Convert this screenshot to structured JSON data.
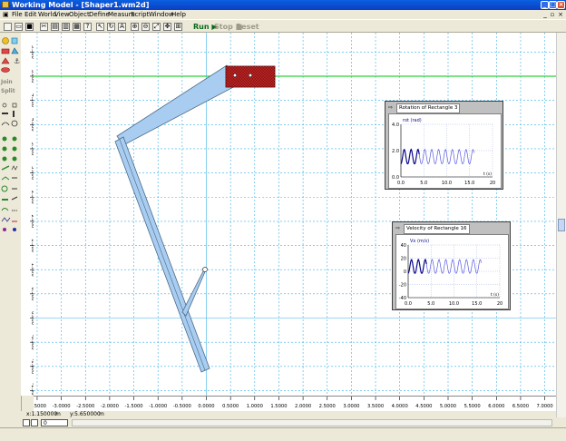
{
  "window": {
    "title": "Working Model - [Shaper1.wm2d]"
  },
  "menu": [
    "File",
    "Edit",
    "World",
    "View",
    "Object",
    "Define",
    "Measure",
    "Script",
    "Window",
    "Help"
  ],
  "toolbar": {
    "run": "Run",
    "stop": "Stop",
    "reset": "Reset"
  },
  "palette": {
    "join": "Join",
    "split": "Split"
  },
  "rulers": {
    "x_ticks": [
      "-3.5000",
      "-3.0000",
      "-2.5000",
      "-2.0000",
      "-1.5000",
      "-1.0000",
      "-0.5000",
      "0.0000",
      "0.5000",
      "1.0000",
      "1.5000",
      "2.0000",
      "2.5000",
      "3.0000",
      "3.5000",
      "4.0000",
      "4.5000",
      "5.0000",
      "5.5000",
      "6.0000",
      "6.5000",
      "7.0000"
    ],
    "y_ticks": [
      "5.500",
      "5.000",
      "4.500",
      "4.000",
      "3.500",
      "3.000",
      "2.500",
      "2.000",
      "1.500",
      "1.000",
      "0.500",
      "0.000",
      "-0.500",
      "-1.000",
      "-1.500"
    ]
  },
  "status": {
    "x": "x:1.150000",
    "x_unit": "m",
    "y": "y:5.650000",
    "y_unit": "m"
  },
  "playback": {
    "frame": "0"
  },
  "graphs": [
    {
      "title": "Rotation of Rectangle 3",
      "series_label": "rot (rad)",
      "x_unit": "t (s)",
      "y_ticks": [
        "4.0",
        "2.0",
        "0.0"
      ],
      "x_ticks": [
        "0.0",
        "5.0",
        "10.0",
        "15.0",
        "20"
      ],
      "chart_data": {
        "type": "line",
        "ylabel": "rot (rad)",
        "xlabel": "t (s)",
        "xlim": [
          0,
          20
        ],
        "ylim": [
          0,
          4
        ],
        "period": 1.5,
        "t_end": 16,
        "y_min": 1.0,
        "y_max": 2.1
      }
    },
    {
      "title": "Velocity of Rectangle 16",
      "series_label": "Vx (m/s)",
      "x_unit": "t (s)",
      "y_ticks": [
        "40",
        "20",
        "0",
        "-20",
        "-40"
      ],
      "x_ticks": [
        "0.0",
        "5.0",
        "10.0",
        "15.0",
        "20"
      ],
      "chart_data": {
        "type": "line",
        "ylabel": "Vx (m/s)",
        "xlabel": "t (s)",
        "xlim": [
          0,
          20
        ],
        "ylim": [
          -40,
          40
        ],
        "period": 1.5,
        "t_end": 16,
        "y_min": -3,
        "y_max": 18
      }
    }
  ],
  "colors": {
    "grid": "#3ab0e8",
    "green_line": "#2ed23a",
    "link_fill": "#a9cdf0",
    "link_stroke": "#4a6a88",
    "block_fill": "#9a1010",
    "trace_dark": "#0a0a8c",
    "trace_light": "#5a5ae0"
  }
}
